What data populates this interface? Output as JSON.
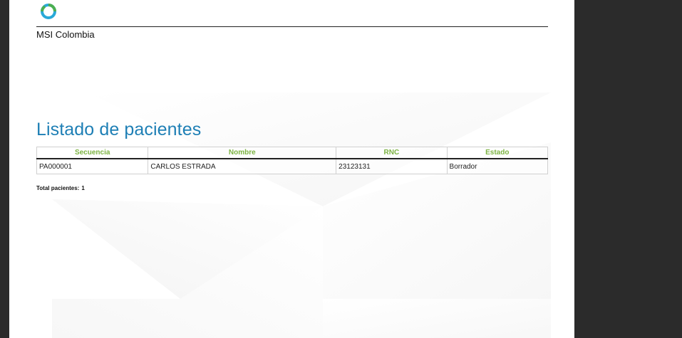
{
  "header": {
    "company_name": "MSI Colombia",
    "logo_icon": "circular-ring-logo",
    "logo_colors": [
      "#2aa9d8",
      "#4caf50"
    ]
  },
  "report": {
    "title": "Listado de pacientes",
    "columns": [
      "Secuencia",
      "Nombre",
      "RNC",
      "Estado"
    ],
    "rows": [
      [
        "PA000001",
        "CARLOS ESTRADA",
        "23123131",
        "Borrador"
      ]
    ],
    "total_label": "Total pacientes:",
    "total_count": "1"
  },
  "colors": {
    "title": "#1e7fb5",
    "column_header": "#7cb342",
    "viewer_background": "#2b2b2b"
  }
}
